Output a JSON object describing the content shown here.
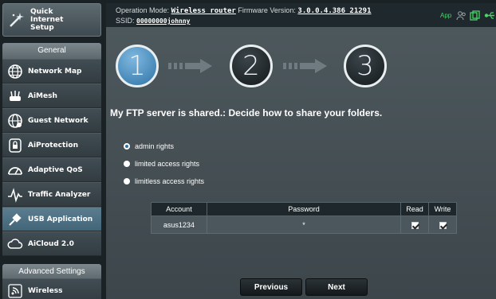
{
  "header": {
    "operation_mode_label": "Operation Mode:",
    "operation_mode_value": "Wireless router",
    "firmware_label": "Firmware Version:",
    "firmware_value": "3.0.0.4.386_21291",
    "ssid_label": "SSID:",
    "ssid_value": "00000000johnny",
    "app_label": "App"
  },
  "sidebar": {
    "quick_setup": "Quick Internet Setup",
    "general_header": "General",
    "items": [
      {
        "label": "Network Map",
        "icon": "globe-icon"
      },
      {
        "label": "AiMesh",
        "icon": "router-icon"
      },
      {
        "label": "Guest Network",
        "icon": "guest-globe-icon"
      },
      {
        "label": "AiProtection",
        "icon": "lock-icon"
      },
      {
        "label": "Adaptive QoS",
        "icon": "speedometer-icon"
      },
      {
        "label": "Traffic Analyzer",
        "icon": "pulse-icon"
      },
      {
        "label": "USB Application",
        "icon": "usb-icon"
      },
      {
        "label": "AiCloud 2.0",
        "icon": "cloud-icon"
      }
    ],
    "advanced_header": "Advanced Settings",
    "advanced_items": [
      {
        "label": "Wireless",
        "icon": "wifi-icon"
      }
    ],
    "active_index": 6
  },
  "wizard": {
    "steps": [
      "1",
      "2",
      "3"
    ],
    "current_step": 1,
    "heading": "My FTP server is shared.: Decide how to share your folders.",
    "options": [
      {
        "label": "admin rights",
        "checked": true
      },
      {
        "label": "limited access rights",
        "checked": false
      },
      {
        "label": "limitless access rights",
        "checked": false
      }
    ],
    "table": {
      "headers": [
        "Account",
        "Password",
        "Read",
        "Write"
      ],
      "rows": [
        {
          "account": "asus1234",
          "password": "*",
          "read": true,
          "write": true
        }
      ]
    },
    "previous_label": "Previous",
    "next_label": "Next"
  },
  "colors": {
    "accent": "#2e73a6",
    "app_green": "#4bd36a"
  }
}
